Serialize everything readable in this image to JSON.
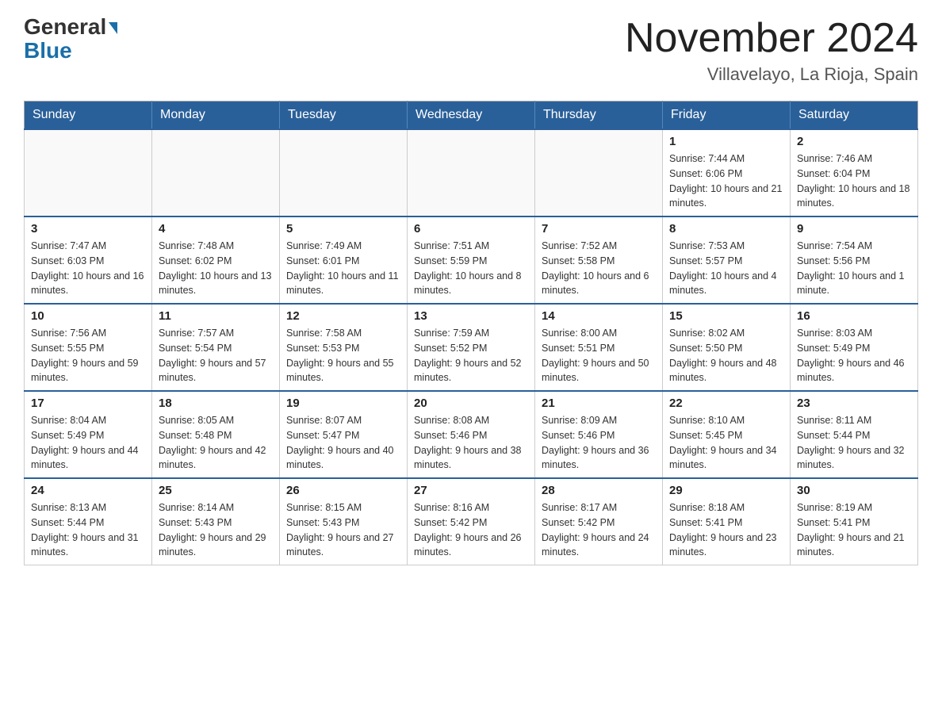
{
  "header": {
    "logo_general": "General",
    "logo_blue": "Blue",
    "month_title": "November 2024",
    "location": "Villavelayo, La Rioja, Spain"
  },
  "days_of_week": [
    "Sunday",
    "Monday",
    "Tuesday",
    "Wednesday",
    "Thursday",
    "Friday",
    "Saturday"
  ],
  "weeks": [
    [
      {
        "day": "",
        "info": ""
      },
      {
        "day": "",
        "info": ""
      },
      {
        "day": "",
        "info": ""
      },
      {
        "day": "",
        "info": ""
      },
      {
        "day": "",
        "info": ""
      },
      {
        "day": "1",
        "info": "Sunrise: 7:44 AM\nSunset: 6:06 PM\nDaylight: 10 hours and 21 minutes."
      },
      {
        "day": "2",
        "info": "Sunrise: 7:46 AM\nSunset: 6:04 PM\nDaylight: 10 hours and 18 minutes."
      }
    ],
    [
      {
        "day": "3",
        "info": "Sunrise: 7:47 AM\nSunset: 6:03 PM\nDaylight: 10 hours and 16 minutes."
      },
      {
        "day": "4",
        "info": "Sunrise: 7:48 AM\nSunset: 6:02 PM\nDaylight: 10 hours and 13 minutes."
      },
      {
        "day": "5",
        "info": "Sunrise: 7:49 AM\nSunset: 6:01 PM\nDaylight: 10 hours and 11 minutes."
      },
      {
        "day": "6",
        "info": "Sunrise: 7:51 AM\nSunset: 5:59 PM\nDaylight: 10 hours and 8 minutes."
      },
      {
        "day": "7",
        "info": "Sunrise: 7:52 AM\nSunset: 5:58 PM\nDaylight: 10 hours and 6 minutes."
      },
      {
        "day": "8",
        "info": "Sunrise: 7:53 AM\nSunset: 5:57 PM\nDaylight: 10 hours and 4 minutes."
      },
      {
        "day": "9",
        "info": "Sunrise: 7:54 AM\nSunset: 5:56 PM\nDaylight: 10 hours and 1 minute."
      }
    ],
    [
      {
        "day": "10",
        "info": "Sunrise: 7:56 AM\nSunset: 5:55 PM\nDaylight: 9 hours and 59 minutes."
      },
      {
        "day": "11",
        "info": "Sunrise: 7:57 AM\nSunset: 5:54 PM\nDaylight: 9 hours and 57 minutes."
      },
      {
        "day": "12",
        "info": "Sunrise: 7:58 AM\nSunset: 5:53 PM\nDaylight: 9 hours and 55 minutes."
      },
      {
        "day": "13",
        "info": "Sunrise: 7:59 AM\nSunset: 5:52 PM\nDaylight: 9 hours and 52 minutes."
      },
      {
        "day": "14",
        "info": "Sunrise: 8:00 AM\nSunset: 5:51 PM\nDaylight: 9 hours and 50 minutes."
      },
      {
        "day": "15",
        "info": "Sunrise: 8:02 AM\nSunset: 5:50 PM\nDaylight: 9 hours and 48 minutes."
      },
      {
        "day": "16",
        "info": "Sunrise: 8:03 AM\nSunset: 5:49 PM\nDaylight: 9 hours and 46 minutes."
      }
    ],
    [
      {
        "day": "17",
        "info": "Sunrise: 8:04 AM\nSunset: 5:49 PM\nDaylight: 9 hours and 44 minutes."
      },
      {
        "day": "18",
        "info": "Sunrise: 8:05 AM\nSunset: 5:48 PM\nDaylight: 9 hours and 42 minutes."
      },
      {
        "day": "19",
        "info": "Sunrise: 8:07 AM\nSunset: 5:47 PM\nDaylight: 9 hours and 40 minutes."
      },
      {
        "day": "20",
        "info": "Sunrise: 8:08 AM\nSunset: 5:46 PM\nDaylight: 9 hours and 38 minutes."
      },
      {
        "day": "21",
        "info": "Sunrise: 8:09 AM\nSunset: 5:46 PM\nDaylight: 9 hours and 36 minutes."
      },
      {
        "day": "22",
        "info": "Sunrise: 8:10 AM\nSunset: 5:45 PM\nDaylight: 9 hours and 34 minutes."
      },
      {
        "day": "23",
        "info": "Sunrise: 8:11 AM\nSunset: 5:44 PM\nDaylight: 9 hours and 32 minutes."
      }
    ],
    [
      {
        "day": "24",
        "info": "Sunrise: 8:13 AM\nSunset: 5:44 PM\nDaylight: 9 hours and 31 minutes."
      },
      {
        "day": "25",
        "info": "Sunrise: 8:14 AM\nSunset: 5:43 PM\nDaylight: 9 hours and 29 minutes."
      },
      {
        "day": "26",
        "info": "Sunrise: 8:15 AM\nSunset: 5:43 PM\nDaylight: 9 hours and 27 minutes."
      },
      {
        "day": "27",
        "info": "Sunrise: 8:16 AM\nSunset: 5:42 PM\nDaylight: 9 hours and 26 minutes."
      },
      {
        "day": "28",
        "info": "Sunrise: 8:17 AM\nSunset: 5:42 PM\nDaylight: 9 hours and 24 minutes."
      },
      {
        "day": "29",
        "info": "Sunrise: 8:18 AM\nSunset: 5:41 PM\nDaylight: 9 hours and 23 minutes."
      },
      {
        "day": "30",
        "info": "Sunrise: 8:19 AM\nSunset: 5:41 PM\nDaylight: 9 hours and 21 minutes."
      }
    ]
  ]
}
